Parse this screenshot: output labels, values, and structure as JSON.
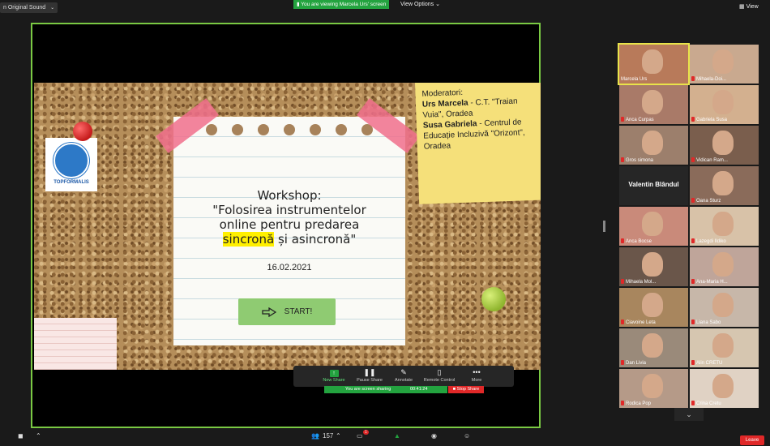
{
  "top": {
    "original_sound": "n Original Sound",
    "viewing_banner": "You are viewing Marcela Urs' screen",
    "view_options": "View Options",
    "view": "View"
  },
  "slide": {
    "logo_text": "TOPFORMALIS",
    "moderators_heading": "Moderatori:",
    "moderator1_name": "Urs Marcela",
    "moderator1_org": " - C.T. \"Traian Vuia\", Oradea",
    "moderator2_name": "Susa Gabriela",
    "moderator2_org": " - Centrul de Educație Incluzivă \"Orizont\", Oradea",
    "workshop_line1": "Workshop:",
    "workshop_line2": "\"Folosirea instrumentelor",
    "workshop_line3": "online pentru predarea",
    "workshop_highlight": "sincronă",
    "workshop_line4_rest": " și asincronă\"",
    "date": "16.02.2021",
    "start_label": "START!"
  },
  "share_toolbar": {
    "new_share": "New Share",
    "pause_share": "Pause Share",
    "annotate": "Annotate",
    "remote_control": "Remote Control",
    "more": "More",
    "sharing_text": "You are screen sharing",
    "timer": "00:41:24",
    "stop_share": "Stop Share"
  },
  "participants": [
    {
      "name": "Marcela Urs",
      "muted": false,
      "video": true
    },
    {
      "name": "Mihaela-Doi...",
      "muted": true,
      "video": true
    },
    {
      "name": "Anca Curpas",
      "muted": true,
      "video": true
    },
    {
      "name": "Gabriela Susa",
      "muted": true,
      "video": true
    },
    {
      "name": "Gros simona",
      "muted": true,
      "video": true
    },
    {
      "name": "Vidican Ram...",
      "muted": true,
      "video": true
    },
    {
      "name": "Valentin Blândul",
      "muted": false,
      "video": false
    },
    {
      "name": "Oana Sturz",
      "muted": true,
      "video": true
    },
    {
      "name": "Anca Bocse",
      "muted": true,
      "video": true
    },
    {
      "name": "Lazegdi Ildiko",
      "muted": true,
      "video": true
    },
    {
      "name": "Mihaela Mol...",
      "muted": true,
      "video": true
    },
    {
      "name": "Ana-Maria H...",
      "muted": true,
      "video": true
    },
    {
      "name": "Ciavoine Leta",
      "muted": true,
      "video": true
    },
    {
      "name": "Liana Sabo",
      "muted": true,
      "video": true
    },
    {
      "name": "Dan Livia",
      "muted": true,
      "video": true
    },
    {
      "name": "Alin CRETU",
      "muted": true,
      "video": true
    },
    {
      "name": "Rodica Pop",
      "muted": true,
      "video": true
    },
    {
      "name": "Crina Cretu",
      "muted": true,
      "video": true
    }
  ],
  "bottom": {
    "participants_count": "157",
    "chat_badge": "1",
    "leave": "Leave"
  },
  "colors": {
    "accent_green": "#23a33f",
    "frame_green": "#7ac943",
    "stop_red": "#e02828",
    "sticky_yellow": "#f5e07a"
  }
}
